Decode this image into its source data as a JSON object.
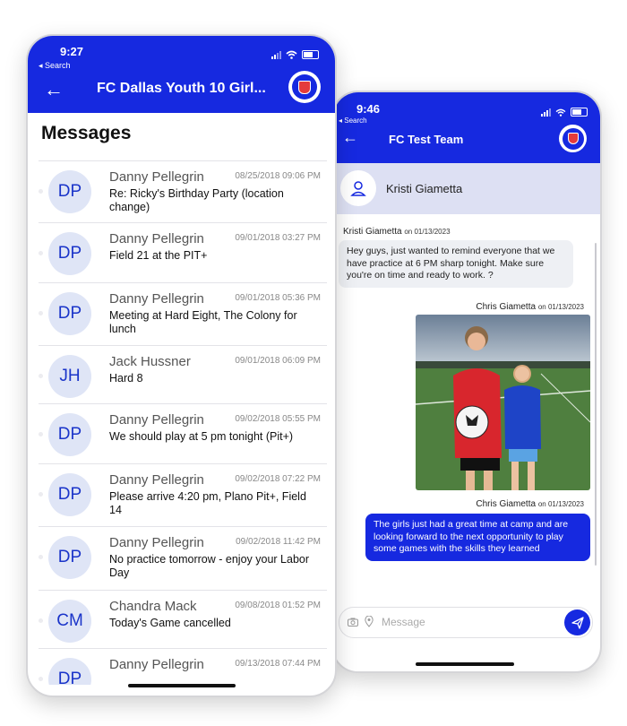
{
  "left_phone": {
    "status_time": "9:27",
    "back_search": "◂ Search",
    "title": "FC Dallas Youth 10 Girl...",
    "heading": "Messages",
    "messages": [
      {
        "initials": "DP",
        "sender": "Danny Pellegrin",
        "timestamp": "08/25/2018 09:06 PM",
        "body": "Re: Ricky's Birthday Party (location change)"
      },
      {
        "initials": "DP",
        "sender": "Danny Pellegrin",
        "timestamp": "09/01/2018 03:27 PM",
        "body": "Field 21 at the PIT+"
      },
      {
        "initials": "DP",
        "sender": "Danny Pellegrin",
        "timestamp": "09/01/2018 05:36 PM",
        "body": "Meeting at Hard Eight, The Colony for lunch"
      },
      {
        "initials": "JH",
        "sender": "Jack Hussner",
        "timestamp": "09/01/2018 06:09 PM",
        "body": "Hard 8"
      },
      {
        "initials": "DP",
        "sender": "Danny Pellegrin",
        "timestamp": "09/02/2018 05:55 PM",
        "body": "We should play at 5 pm tonight (Pit+)"
      },
      {
        "initials": "DP",
        "sender": "Danny Pellegrin",
        "timestamp": "09/02/2018 07:22 PM",
        "body": "Please arrive 4:20 pm, Plano Pit+, Field 14"
      },
      {
        "initials": "DP",
        "sender": "Danny Pellegrin",
        "timestamp": "09/02/2018 11:42 PM",
        "body": "No practice tomorrow - enjoy your Labor Day"
      },
      {
        "initials": "CM",
        "sender": "Chandra Mack",
        "timestamp": "09/08/2018 01:52 PM",
        "body": "Today's Game cancelled"
      },
      {
        "initials": "DP",
        "sender": "Danny Pellegrin",
        "timestamp": "09/13/2018 07:44 PM",
        "body": ""
      }
    ]
  },
  "right_phone": {
    "status_time": "9:46",
    "back_search": "◂ Search",
    "title": "FC Test Team",
    "contact_name": "Kristi Giametta",
    "chat": [
      {
        "sender": "Kristi Giametta",
        "date": "on 01/13/2023",
        "text": "Hey guys, just wanted to remind everyone that we have practice at 6 PM sharp tonight. Make sure you're on time and ready to work. ?"
      },
      {
        "sender": "Chris Giametta",
        "date": "on 01/13/2023",
        "text": ""
      },
      {
        "sender": "Chris Giametta",
        "date": "on 01/13/2023",
        "text": "The girls just had a great time at camp and are looking forward to the next opportunity to play some games with the skills they learned"
      }
    ],
    "composer_placeholder": "Message"
  },
  "colors": {
    "brand_blue": "#1629e0",
    "avatar_bg": "#dfe5f6",
    "contact_bar": "#dde0f3"
  },
  "icons": [
    "back-arrow-icon",
    "team-logo-icon",
    "user-icon",
    "camera-icon",
    "location-pin-icon",
    "send-icon",
    "signal-icon",
    "wifi-icon",
    "battery-icon"
  ]
}
